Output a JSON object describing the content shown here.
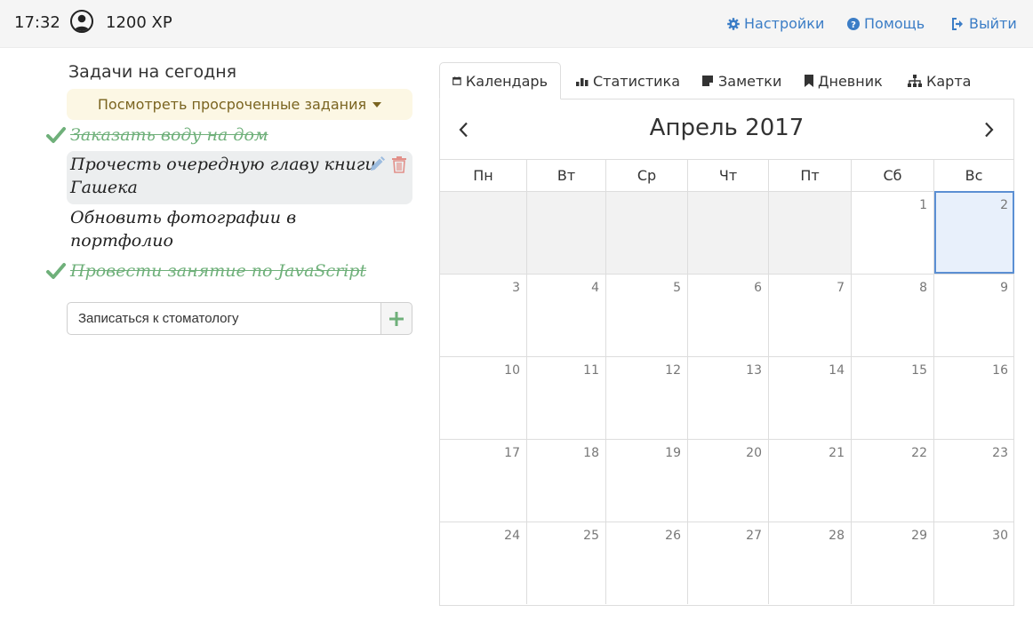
{
  "header": {
    "time": "17:32",
    "xp": "1200 XP",
    "links": [
      {
        "label": "Настройки",
        "icon": "gear-icon"
      },
      {
        "label": "Помощь",
        "icon": "question-icon"
      },
      {
        "label": "Выйти",
        "icon": "sign-out-icon"
      }
    ]
  },
  "tasks": {
    "title": "Задачи на сегодня",
    "overdue_label": "Посмотреть просроченные задания",
    "items": [
      {
        "text": "Заказать воду на дом",
        "done": true
      },
      {
        "text": "Прочесть очередную главу книги Гашека",
        "done": false,
        "selected": true
      },
      {
        "text": "Обновить фотографии в портфолио",
        "done": false
      },
      {
        "text": "Провести занятие по JavaScript",
        "done": true
      }
    ],
    "new_task_value": "Записаться к стоматологу"
  },
  "tabs": [
    {
      "label": "Календарь",
      "icon": "calendar-icon",
      "active": true
    },
    {
      "label": "Статистика",
      "icon": "bar-chart-icon"
    },
    {
      "label": "Заметки",
      "icon": "note-icon"
    },
    {
      "label": "Дневник",
      "icon": "bookmark-icon"
    },
    {
      "label": "Карта",
      "icon": "sitemap-icon"
    }
  ],
  "calendar": {
    "month_title": "Апрель 2017",
    "weekdays": [
      "Пн",
      "Вт",
      "Ср",
      "Чт",
      "Пт",
      "Сб",
      "Вс"
    ],
    "days": [
      "",
      "",
      "",
      "",
      "",
      "1",
      "2",
      "3",
      "4",
      "5",
      "6",
      "7",
      "8",
      "9",
      "10",
      "11",
      "12",
      "13",
      "14",
      "15",
      "16",
      "17",
      "18",
      "19",
      "20",
      "21",
      "22",
      "23",
      "24",
      "25",
      "26",
      "27",
      "28",
      "29",
      "30"
    ],
    "today": "2"
  },
  "colors": {
    "accent": "#3b7dc6",
    "done": "#6fb07a",
    "overdue_bg": "#fcf7e4",
    "today_border": "#5b8fd3"
  }
}
